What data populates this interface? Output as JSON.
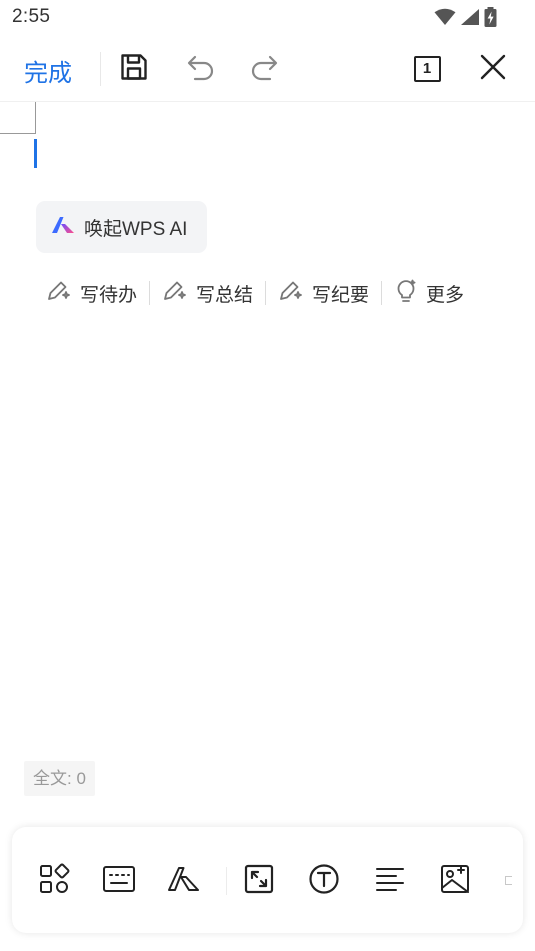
{
  "status_bar": {
    "time": "2:55"
  },
  "toolbar": {
    "done_label": "完成",
    "page_count": "1"
  },
  "ai_chip": {
    "label": "唤起WPS AI"
  },
  "suggestions": [
    {
      "label": "写待办"
    },
    {
      "label": "写总结"
    },
    {
      "label": "写纪要"
    },
    {
      "label": "更多"
    }
  ],
  "footer": {
    "word_count": "全文: 0"
  },
  "colors": {
    "accent": "#1f73e6",
    "icon": "#222222",
    "muted": "#999999"
  }
}
